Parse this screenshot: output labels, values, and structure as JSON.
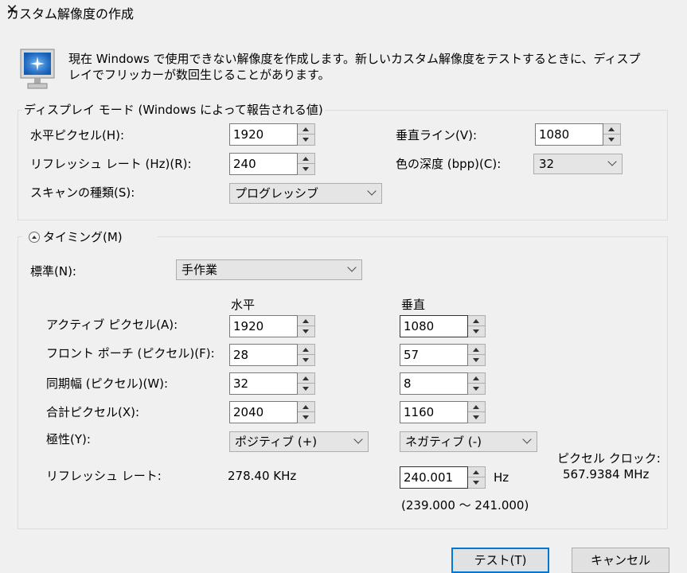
{
  "window": {
    "title": "カスタム解像度の作成"
  },
  "description": "現在 Windows で使用できない解像度を作成します。新しいカスタム解像度をテストするときに、ディスプレイでフリッカーが数回生じることがあります。",
  "display_mode": {
    "legend": "ディスプレイ モード (Windows によって報告される値)",
    "horizontal_pixels_label": "水平ピクセル(H):",
    "horizontal_pixels_value": "1920",
    "vertical_lines_label": "垂直ライン(V):",
    "vertical_lines_value": "1080",
    "refresh_rate_label": "リフレッシュ レート (Hz)(R):",
    "refresh_rate_value": "240",
    "color_depth_label": "色の深度 (bpp)(C):",
    "color_depth_value": "32",
    "scan_type_label": "スキャンの種類(S):",
    "scan_type_value": "プログレッシブ"
  },
  "timing": {
    "legend": "タイミング(M)",
    "standard_label": "標準(N):",
    "standard_value": "手作業",
    "col_horizontal": "水平",
    "col_vertical": "垂直",
    "active_pixels_label": "アクティブ ピクセル(A):",
    "active_h": "1920",
    "active_v": "1080",
    "front_porch_label": "フロント ポーチ (ピクセル)(F):",
    "front_h": "28",
    "front_v": "57",
    "sync_width_label": "同期幅 (ピクセル)(W):",
    "sync_h": "32",
    "sync_v": "8",
    "total_pixels_label": "合計ピクセル(X):",
    "total_h": "2040",
    "total_v": "1160",
    "polarity_label": "極性(Y):",
    "polarity_h": "ポジティブ (+)",
    "polarity_v": "ネガティブ (-)",
    "refresh_label": "リフレッシュ レート:",
    "refresh_h_text": "278.40 KHz",
    "refresh_v_value": "240.001",
    "refresh_v_unit": "Hz",
    "refresh_range": "(239.000 ～ 241.000)",
    "pixel_clock_label": "ピクセル クロック:",
    "pixel_clock_value": "567.9384 MHz"
  },
  "buttons": {
    "test": "テスト(T)",
    "cancel": "キャンセル"
  }
}
